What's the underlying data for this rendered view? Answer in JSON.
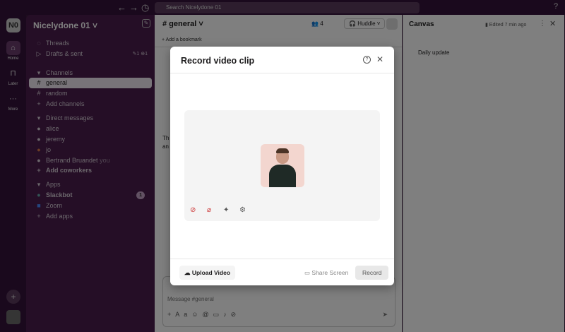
{
  "search": {
    "placeholder": "Search Nicelydone 01"
  },
  "workspace": {
    "initials": "N0",
    "name": "Nicelydone 01"
  },
  "rail": [
    {
      "label": "Home"
    },
    {
      "label": "Later"
    },
    {
      "label": "More"
    }
  ],
  "sidebar": {
    "threads": "Threads",
    "drafts": "Drafts & sent",
    "drafts_counts": "✎1  ⊕1",
    "channels_header": "Channels",
    "channels": [
      "general",
      "random"
    ],
    "add_channels": "Add channels",
    "dm_header": "Direct messages",
    "dms": [
      "alice",
      "jeremy",
      "jo",
      "Bertrand Bruandet"
    ],
    "you": "you",
    "add_coworkers": "Add coworkers",
    "apps_header": "Apps",
    "apps": [
      "Slackbot",
      "Zoom"
    ],
    "slackbot_badge": "1",
    "add_apps": "Add apps"
  },
  "channel": {
    "name": "# general",
    "members": "4",
    "huddle": "Huddle",
    "bookmark": "Add a bookmark",
    "composer_placeholder": "Message #general",
    "snippet1": "Th",
    "snippet2": "an"
  },
  "canvas": {
    "title": "Canvas",
    "edited": "Edited 7 min ago",
    "content": "Daily update"
  },
  "modal": {
    "title": "Record video clip",
    "upload": "Upload Video",
    "share": "Share Screen",
    "record": "Record"
  }
}
